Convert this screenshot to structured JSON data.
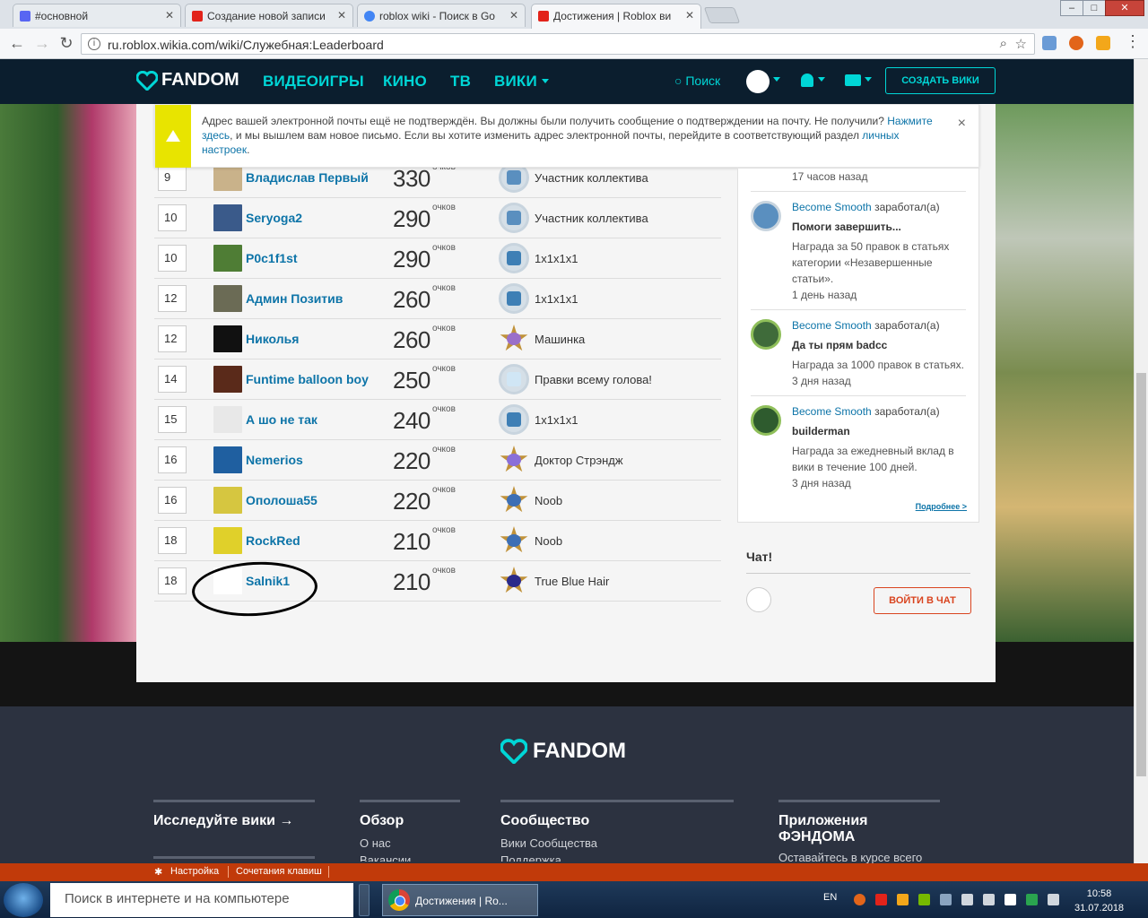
{
  "browser": {
    "tabs": [
      {
        "title": "#основной",
        "color": "#5865f2"
      },
      {
        "title": "Создание новой записи",
        "color": "#e2231a"
      },
      {
        "title": "roblox wiki - Поиск в Go",
        "color": "#4285f4"
      },
      {
        "title": "Достижения | Roblox ви",
        "color": "#e2231a"
      }
    ],
    "url": "ru.roblox.wikia.com/wiki/Служебная:Leaderboard",
    "window_buttons": {
      "minimize": "–",
      "maximize": "□",
      "close": "✕"
    }
  },
  "fandom_nav": {
    "logo": "FANDOM",
    "links": [
      "ВИДЕОИГРЫ",
      "КИНО",
      "ТВ",
      "ВИКИ"
    ],
    "search": "Поиск",
    "create_wiki": "СОЗДАТЬ ВИКИ"
  },
  "notice": {
    "text_before": "Адрес вашей электронной почты ещё не подтверждён. Вы должны были получить сообщение о подтверждении на почту. Не получили? ",
    "link1": "Нажмите здесь",
    "text_middle": ", и мы вышлем вам новое письмо. Если вы хотите изменить адрес электронной почты, перейдите в соответствующий раздел ",
    "link2": "личных настроек",
    "text_after": ".",
    "close": "×"
  },
  "leaderboard": {
    "unit": "очков",
    "rows": [
      {
        "rank": "9",
        "user": "Владислав Первый",
        "score": "330",
        "badge": "Участник коллектива",
        "avatar_color": "#c9b28a",
        "badge_kind": "circle",
        "badge_color": "#5a8fbf"
      },
      {
        "rank": "10",
        "user": "Seryoga2",
        "score": "290",
        "badge": "Участник коллектива",
        "avatar_color": "#3a5a8a",
        "badge_kind": "circle",
        "badge_color": "#5a8fbf"
      },
      {
        "rank": "10",
        "user": "P0c1f1st",
        "score": "290",
        "badge": "1x1x1x1",
        "avatar_color": "#4f7d35",
        "badge_kind": "circle",
        "badge_color": "#3e7fb5"
      },
      {
        "rank": "12",
        "user": "Админ Позитив",
        "score": "260",
        "badge": "1x1x1x1",
        "avatar_color": "#6b6b55",
        "badge_kind": "circle",
        "badge_color": "#3e7fb5"
      },
      {
        "rank": "12",
        "user": "Николья",
        "score": "260",
        "badge": "Машинка",
        "avatar_color": "#111111",
        "badge_kind": "star",
        "badge_color": "#9a6fc9"
      },
      {
        "rank": "14",
        "user": "Funtime balloon boy",
        "score": "250",
        "badge": "Правки всему голова!",
        "avatar_color": "#5a2a1a",
        "badge_kind": "circle",
        "badge_color": "#d0e6f5"
      },
      {
        "rank": "15",
        "user": "А шо не так",
        "score": "240",
        "badge": "1x1x1x1",
        "avatar_color": "#e8e8e8",
        "badge_kind": "circle",
        "badge_color": "#3e7fb5"
      },
      {
        "rank": "16",
        "user": "Nemerios",
        "score": "220",
        "badge": "Доктор Стрэндж",
        "avatar_color": "#1f5fa0",
        "badge_kind": "star",
        "badge_color": "#8a6fd9"
      },
      {
        "rank": "16",
        "user": "Ополоша55",
        "score": "220",
        "badge": "Noob",
        "avatar_color": "#d6c640",
        "badge_kind": "star",
        "badge_color": "#3d6fb5"
      },
      {
        "rank": "18",
        "user": "RockRed",
        "score": "210",
        "badge": "Noob",
        "avatar_color": "#e0d02a",
        "badge_kind": "star",
        "badge_color": "#3d6fb5"
      },
      {
        "rank": "18",
        "user": "Salnik1",
        "score": "210",
        "badge": "True Blue Hair",
        "avatar_color": "#ffffff",
        "badge_kind": "star",
        "badge_color": "#2a2a8a"
      }
    ]
  },
  "activity": {
    "first_time": "17 часов назад",
    "earned_word": "заработал(а)",
    "items": [
      {
        "who": "Become Smooth",
        "title": "Помоги завершить...",
        "desc": "Награда за 50 правок в статьях категории «Незавершенные статьи».",
        "time": "1 день назад",
        "icon_color": "#5a8fbf"
      },
      {
        "who": "Become Smooth",
        "title": "Да ты прям badcc",
        "desc": "Награда за 1000 правок в статьях.",
        "time": "3 дня назад",
        "icon_color": "#3f6b3a"
      },
      {
        "who": "Become Smooth",
        "title": "builderman",
        "desc": "Награда за ежедневный вклад в вики в течение 100 дней.",
        "time": "3 дня назад",
        "icon_color": "#2e5b2e"
      }
    ],
    "more": "Подробнее >"
  },
  "chat": {
    "heading": "Чат!",
    "button": "ВОЙТИ В ЧАТ"
  },
  "footer": {
    "logo": "FANDOM",
    "explore": "Исследуйте вики",
    "overview": {
      "title": "Обзор",
      "item": "О нас",
      "item2": "Вакансии"
    },
    "community": {
      "title": "Сообщество",
      "item": "Вики Сообщества",
      "item2": "Поддержка"
    },
    "apps": {
      "title": "Приложения ФЭНДОМА",
      "item": "Оставайтесь в курсе всего"
    }
  },
  "toolbar_bottom": {
    "settings": "Настройка",
    "shortcuts": "Сочетания клавиш"
  },
  "taskbar": {
    "search_placeholder": "Поиск в интернете и на компьютере",
    "chrome_label": "Достижения | Ro...",
    "lang": "EN",
    "time": "10:58",
    "date": "31.07.2018"
  }
}
